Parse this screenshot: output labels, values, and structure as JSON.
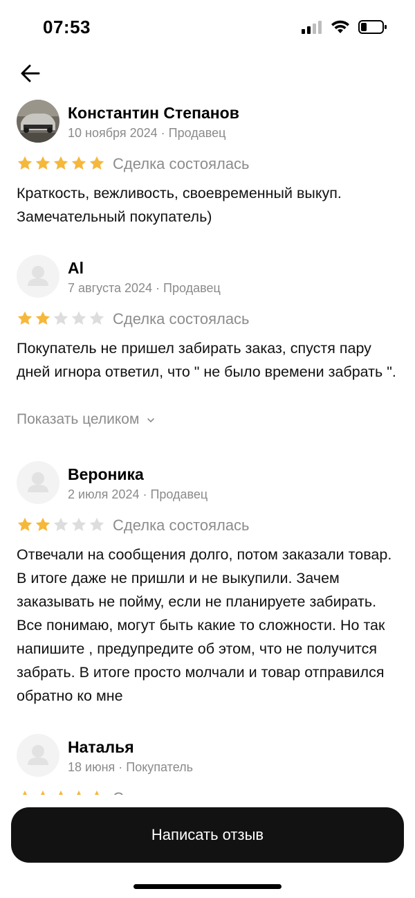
{
  "status": {
    "time": "07:53"
  },
  "colors": {
    "star_filled": "#F5B83B",
    "star_empty": "#DDDDDD",
    "button_bg": "#121212",
    "meta_text": "#8A8A8A"
  },
  "reviews": [
    {
      "name": "Константин Степанов",
      "meta": "10 ноября 2024 · Продавец",
      "rating": 5,
      "status": "Сделка состоялась",
      "text": "Краткость, вежливость, своевременный выкуп. Замечательный покупатель)",
      "avatar": "car-photo"
    },
    {
      "name": "Al",
      "meta": "7 августа 2024 · Продавец",
      "rating": 2,
      "status": "Сделка состоялась",
      "text": "Покупатель не пришел забирать заказ,  спустя пару дней игнора ответил, что \" не было времени забрать \".",
      "show_more": "Показать целиком",
      "avatar": "default-user"
    },
    {
      "name": "Вероника",
      "meta": "2 июля 2024 · Продавец",
      "rating": 2,
      "status": "Сделка состоялась",
      "text": "Отвечали на сообщения долго, потом заказали товар. В итоге даже не пришли и не выкупили. Зачем заказывать не пойму, если не планируете забирать. Все понимаю, могут быть какие то сложности. Но так напишите , предупредите об этом, что не получится забрать. В итоге просто молчали и товар отправился обратно ко мне",
      "avatar": "default-user"
    },
    {
      "name": "Наталья",
      "meta": "18 июня · Покупатель",
      "rating": 5,
      "status": "Сделка состоялась",
      "text": "",
      "avatar": "default-user"
    }
  ],
  "write_button": {
    "label": "Написать отзыв"
  }
}
